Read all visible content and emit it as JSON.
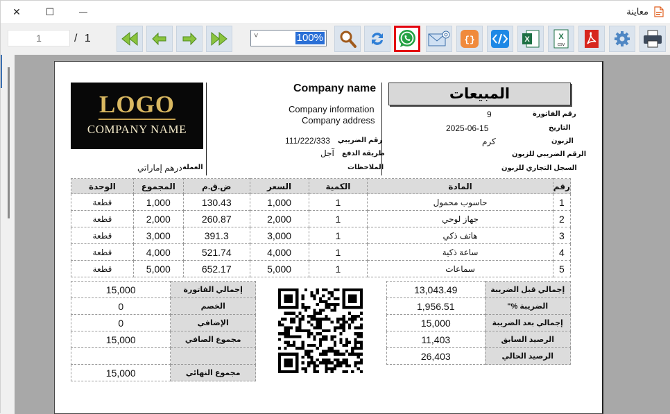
{
  "window": {
    "title": "معاينة",
    "close_glyph": "✕",
    "maximize_glyph": "☐",
    "minimize_glyph": "—"
  },
  "toolbar": {
    "page_current": "1",
    "page_of": "/ 1",
    "zoom": "100%",
    "zoom_arrow": "˅",
    "icons": [
      "first-page-icon",
      "prev-page-icon",
      "next-page-icon",
      "last-page-icon",
      "search-icon",
      "refresh-icon",
      "whatsapp-icon",
      "email-icon",
      "json-icon",
      "html-icon",
      "excel-icon",
      "csv-icon",
      "pdf-icon",
      "settings-icon",
      "print-icon"
    ],
    "highlight_color": "#e3000f"
  },
  "logo": {
    "line1": "LOGO",
    "line2": "COMPANY NAME"
  },
  "company": {
    "name": "Company name",
    "info": "Company information",
    "address": "Company address",
    "tax_label": "رقم الضريبي",
    "tax_value": "111/222/333",
    "payment_label": "طريقة الدفع",
    "payment_value": "آجل",
    "notes_label": "الملاحظات",
    "currency_label": "العملة",
    "currency_value": "درهم إماراتي"
  },
  "invoice": {
    "title": "المبيعات",
    "number_label": "رقم الفاتورة",
    "number_value": "9",
    "date_label": "التاريخ",
    "date_value": "2025-06-15",
    "customer_label": "الزبون",
    "customer_value": "كرم",
    "customer_tax_label": "الرقم الضريبي للزبون",
    "customer_reg_label": "السجل التجاري للزبون"
  },
  "items": {
    "headers": {
      "no": "رقم",
      "item": "المادة",
      "qty": "الكمية",
      "price": "السعر",
      "vat": "ض.ق.م",
      "total": "المجموع",
      "unit": "الوحدة"
    },
    "rows": [
      {
        "no": "1",
        "item": "حاسوب محمول",
        "qty": "1",
        "price": "1,000",
        "vat": "130.43",
        "total": "1,000",
        "unit": "قطعة"
      },
      {
        "no": "2",
        "item": "جهاز لوحي",
        "qty": "1",
        "price": "2,000",
        "vat": "260.87",
        "total": "2,000",
        "unit": "قطعة"
      },
      {
        "no": "3",
        "item": "هاتف ذكي",
        "qty": "1",
        "price": "3,000",
        "vat": "391.3",
        "total": "3,000",
        "unit": "قطعة"
      },
      {
        "no": "4",
        "item": "ساعة ذكية",
        "qty": "1",
        "price": "4,000",
        "vat": "521.74",
        "total": "4,000",
        "unit": "قطعة"
      },
      {
        "no": "5",
        "item": "سماعات",
        "qty": "1",
        "price": "5,000",
        "vat": "652.17",
        "total": "5,000",
        "unit": "قطعة"
      }
    ]
  },
  "totals_left": [
    {
      "label": "إجمالي الفاتورة",
      "value": "15,000"
    },
    {
      "label": "الخصم",
      "value": "0"
    },
    {
      "label": "الإضافي",
      "value": "0"
    },
    {
      "label": "مجموع الصافي",
      "value": "15,000"
    },
    {
      "label": "",
      "value": ""
    },
    {
      "label": "مجموع النهائي",
      "value": "15,000"
    }
  ],
  "totals_right": [
    {
      "label": "إجمالي قبل الضريبة",
      "value": "13,043.49"
    },
    {
      "label": "الضريبة %\"",
      "value": "1,956.51"
    },
    {
      "label": "إجمالي بعد الضريبة",
      "value": "15,000"
    },
    {
      "label": "الرصيد السابق",
      "value": "11,403"
    },
    {
      "label": "الرصيد الحالي",
      "value": "26,403"
    }
  ]
}
